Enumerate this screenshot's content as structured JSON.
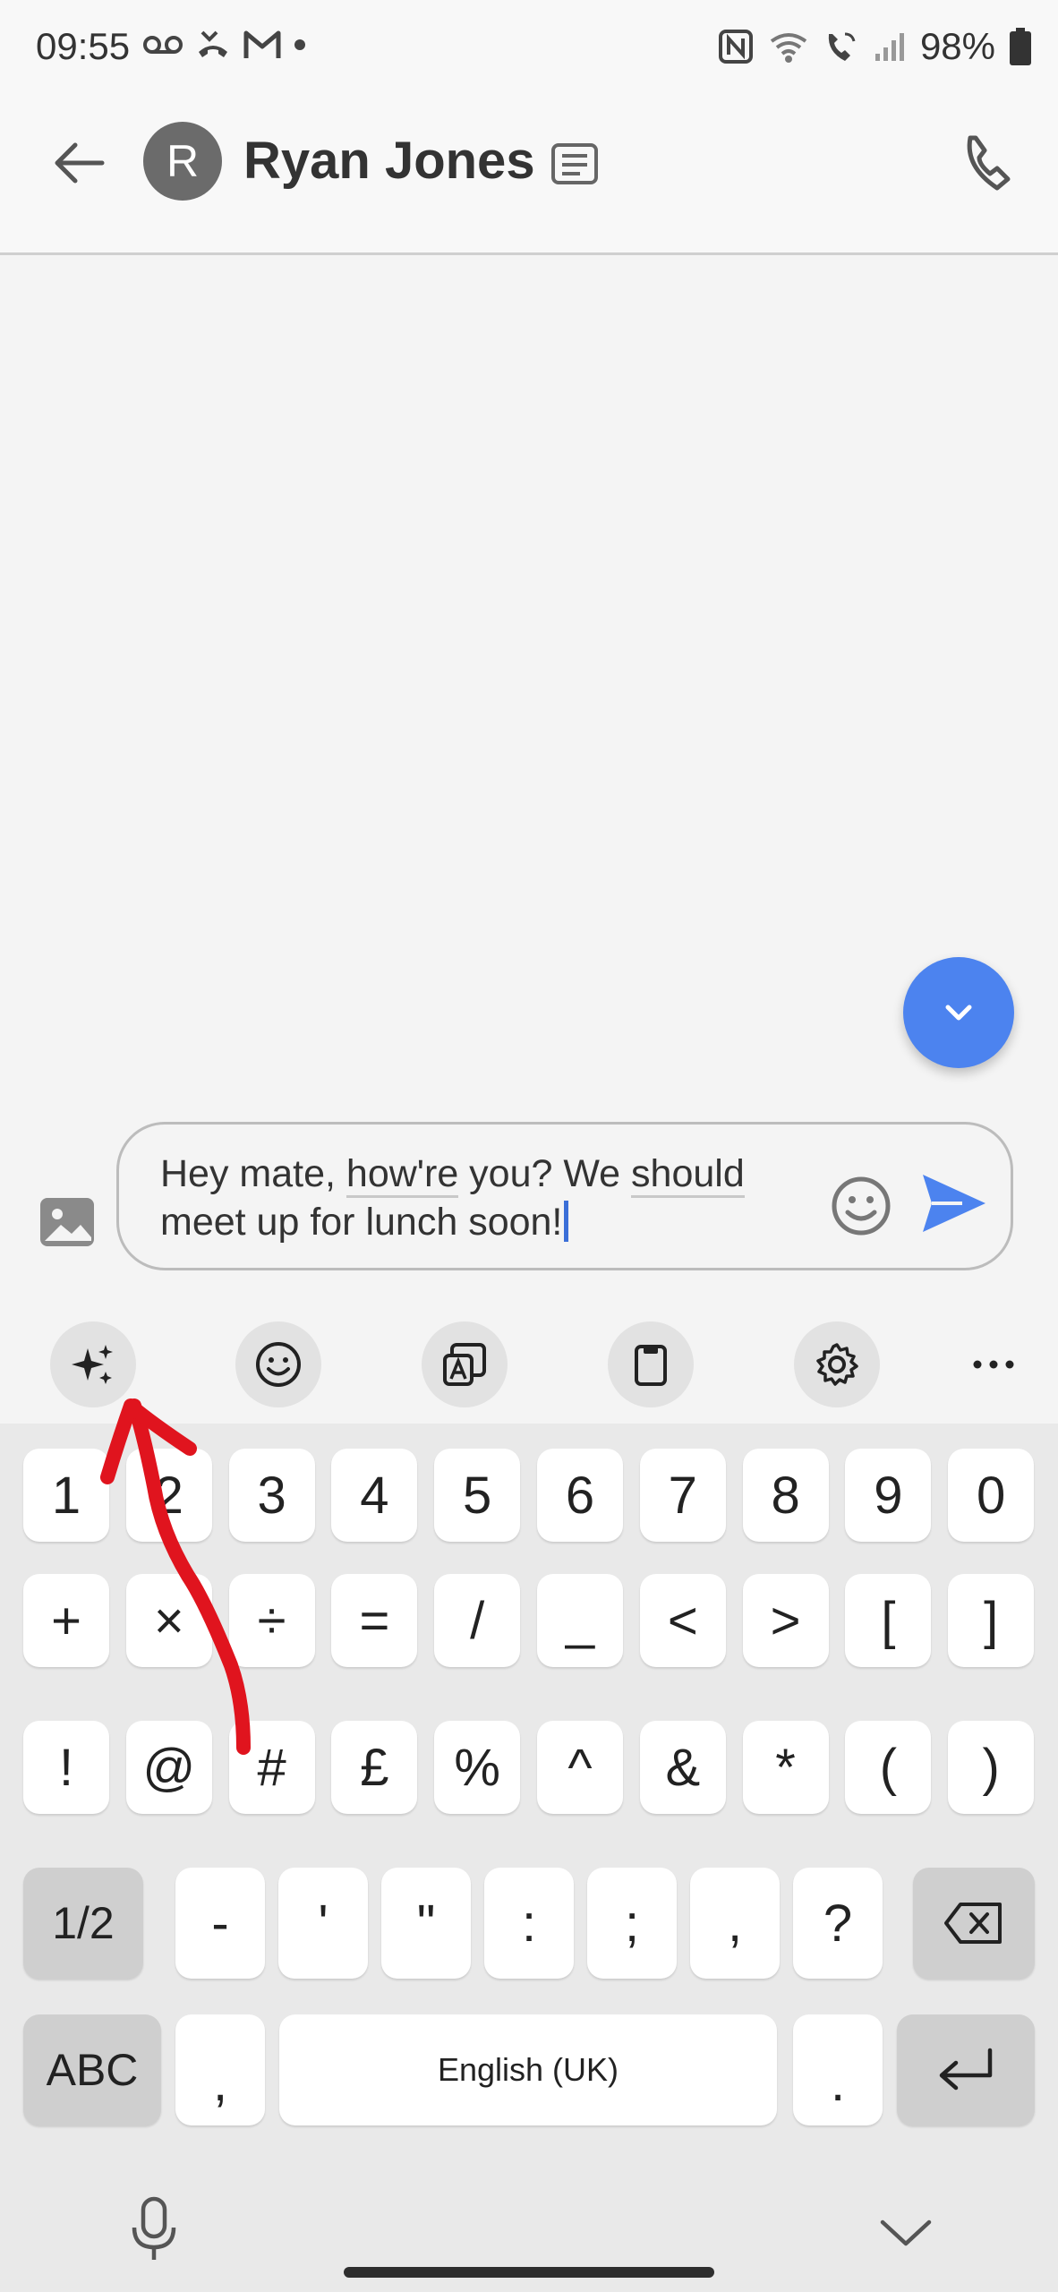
{
  "status_bar": {
    "time": "09:55",
    "battery": "98%"
  },
  "app_bar": {
    "avatar_initial": "R",
    "contact_name": "Ryan Jones"
  },
  "compose": {
    "line1_pre": "Hey mate, ",
    "word_hows": "how're",
    "line1_mid": " you? We ",
    "word_should": "should",
    "line2": "meet up for lunch soon!"
  },
  "keyboard": {
    "row1": [
      "1",
      "2",
      "3",
      "4",
      "5",
      "6",
      "7",
      "8",
      "9",
      "0"
    ],
    "row2": [
      "+",
      "×",
      "÷",
      "=",
      "/",
      "_",
      "<",
      ">",
      "[",
      "]"
    ],
    "row3": [
      "!",
      "@",
      "#",
      "£",
      "%",
      "^",
      "&",
      "*",
      "(",
      ")"
    ],
    "row4_switch": "1/2",
    "row4": [
      "-",
      "'",
      "\"",
      ":",
      ";",
      ",",
      "?"
    ],
    "abc": "ABC",
    "comma": ",",
    "space": "English (UK)",
    "period": "."
  },
  "colors": {
    "accent": "#4c83ef",
    "send": "#4c83ef",
    "annotation": "#e0141e"
  },
  "icons": [
    "back-arrow-icon",
    "contact-details-icon",
    "phone-icon",
    "chevron-down-icon",
    "image-icon",
    "emoji-icon",
    "send-icon",
    "sparkle-ai-icon",
    "keyboard-emoji-icon",
    "translate-icon",
    "clipboard-icon",
    "settings-icon",
    "more-icon",
    "backspace-icon",
    "enter-icon",
    "microphone-icon",
    "hide-keyboard-icon"
  ]
}
